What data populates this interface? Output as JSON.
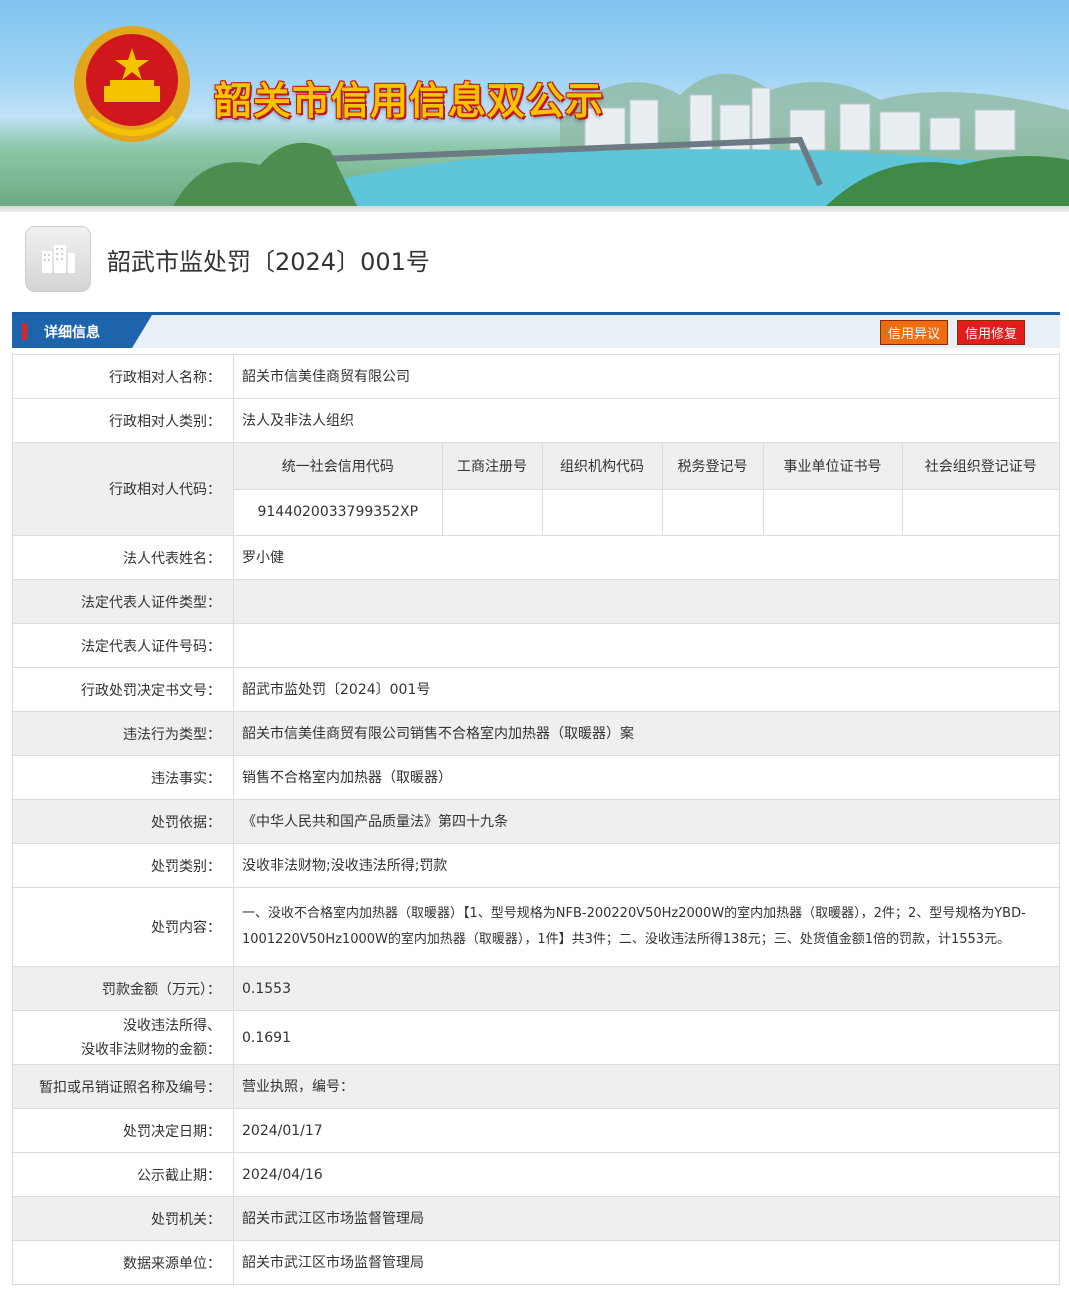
{
  "banner": {
    "title": "韶关市信用信息双公示"
  },
  "document": {
    "title": "韶武市监处罚〔2024〕001号"
  },
  "section": {
    "label": "详细信息"
  },
  "actions": {
    "dispute_label": "信用异议",
    "repair_label": "信用修复"
  },
  "subject_code": {
    "label": "行政相对人代码：",
    "headers": [
      "统一社会信用代码",
      "工商注册号",
      "组织机构代码",
      "税务登记号",
      "事业单位证书号",
      "社会组织登记证号"
    ],
    "values": [
      "9144020033799352XP",
      "",
      "",
      "",
      "",
      ""
    ]
  },
  "rows": [
    {
      "label": "行政相对人名称：",
      "value": "韶关市信美佳商贸有限公司"
    },
    {
      "label": "行政相对人类别：",
      "value": "法人及非法人组织"
    },
    {
      "label": "法人代表姓名：",
      "value": "罗小健"
    },
    {
      "label": "法定代表人证件类型：",
      "value": ""
    },
    {
      "label": "法定代表人证件号码：",
      "value": ""
    },
    {
      "label": "行政处罚决定书文号：",
      "value": "韶武市监处罚〔2024〕001号"
    },
    {
      "label": "违法行为类型：",
      "value": "韶关市信美佳商贸有限公司销售不合格室内加热器（取暖器）案"
    },
    {
      "label": "违法事实：",
      "value": "销售不合格室内加热器（取暖器）"
    },
    {
      "label": "处罚依据：",
      "value": "《中华人民共和国产品质量法》第四十九条"
    },
    {
      "label": "处罚类别：",
      "value": "没收非法财物;没收违法所得;罚款"
    },
    {
      "label": "处罚内容：",
      "value": "一、没收不合格室内加热器（取暖器）【1、型号规格为NFB-200220V50Hz2000W的室内加热器（取暖器），2件；2、型号规格为YBD-1001220V50Hz1000W的室内加热器（取暖器），1件】共3件；二、没收违法所得138元；三、处货值金额1倍的罚款，计1553元。"
    },
    {
      "label": "罚款金额（万元）：",
      "value": "0.1553"
    },
    {
      "label_line1": "没收违法所得、",
      "label_line2": "没收非法财物的金额：",
      "value": "0.1691"
    },
    {
      "label": "暂扣或吊销证照名称及编号：",
      "value": "营业执照，编号："
    },
    {
      "label": "处罚决定日期：",
      "value": "2024/01/17"
    },
    {
      "label": "公示截止期：",
      "value": "2024/04/16"
    },
    {
      "label": "处罚机关：",
      "value": "韶关市武江区市场监督管理局"
    },
    {
      "label": "数据来源单位：",
      "value": "韶关市武江区市场监督管理局"
    }
  ]
}
